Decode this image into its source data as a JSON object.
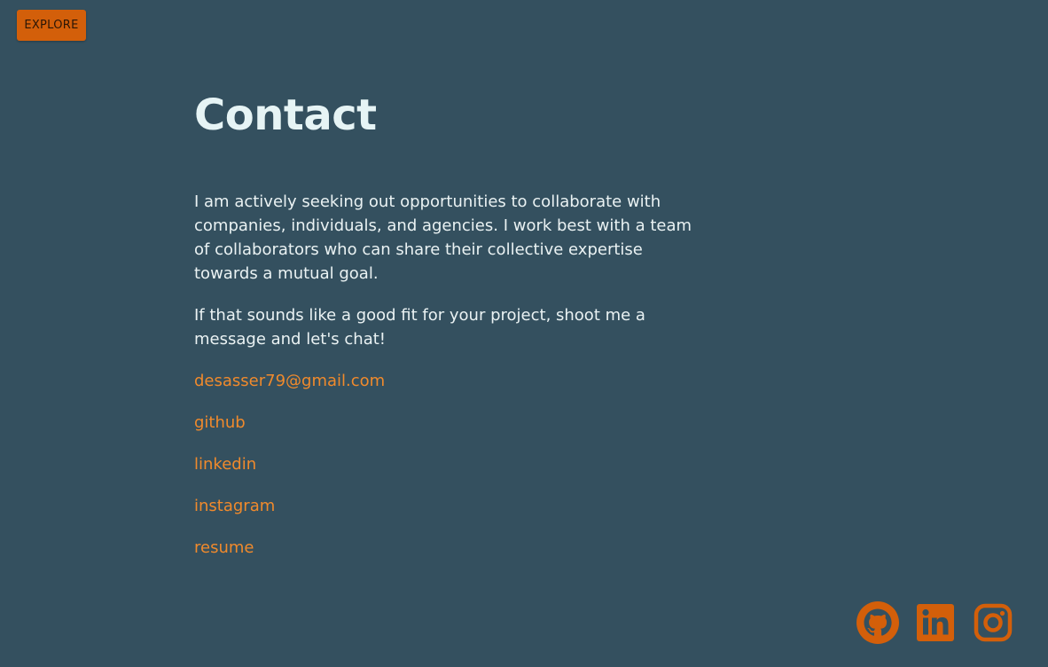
{
  "nav": {
    "explore_label": "EXPLORE"
  },
  "main": {
    "title": "Contact",
    "paragraphs": [
      "I am actively seeking out opportunities to collaborate with companies, individuals, and agencies. I work best with a team of collaborators who can share their collective expertise towards a mutual goal.",
      "If that sounds like a good fit for your project, shoot me a message and let's chat!"
    ],
    "links": [
      "desasser79@gmail.com",
      "github",
      "linkedin",
      "instagram",
      "resume"
    ]
  },
  "social": {
    "icons": [
      "github-icon",
      "linkedin-icon",
      "instagram-icon"
    ]
  },
  "colors": {
    "background": "#34505f",
    "accent": "#d35f0a",
    "link": "#f08a2c",
    "heading": "#e6f4f5"
  }
}
